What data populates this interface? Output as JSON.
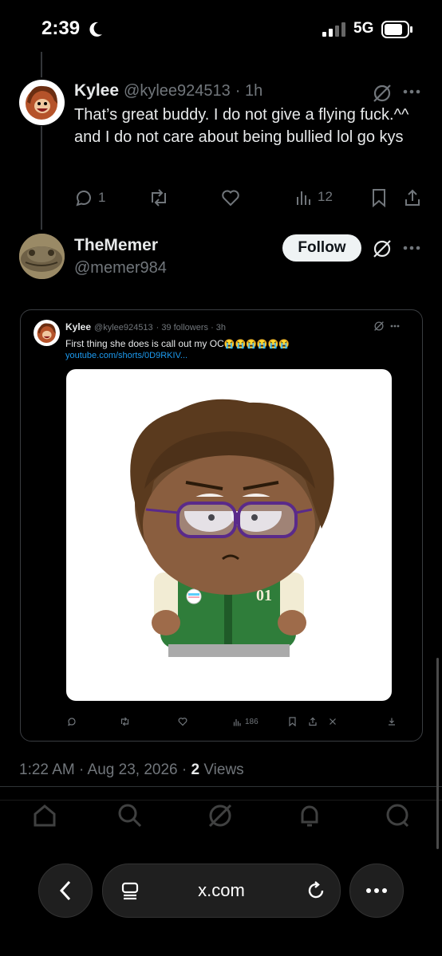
{
  "status_bar": {
    "time": "2:39",
    "network": "5G"
  },
  "reply_tweet": {
    "name": "Kylee",
    "handle": "@kylee924513",
    "time": "· 1h",
    "text": "That’s great buddy. I do not give a flying fuck.^^ and I do not care about being bullied lol go kys",
    "replies": "1",
    "views": "12"
  },
  "main_tweet": {
    "name": "TheMemer",
    "handle": "@memer984",
    "follow_label": "Follow",
    "timestamp": "1:22 AM · Aug 23, 2026 · ",
    "views_count": "2",
    "views_label": "Views"
  },
  "embedded_screenshot": {
    "name": "Kylee",
    "handle": "@kylee924513",
    "meta": "· 39 followers · 3h",
    "text": "First thing she does is call out my OC",
    "emoji": "😭😭😭😭😭😭",
    "link": "youtube.com/shorts/0D9RKIV...",
    "views": "186",
    "badge_text": "01"
  },
  "browser": {
    "url": "x.com"
  },
  "colors": {
    "background": "#000000",
    "text": "#e7e9ea",
    "muted": "#71767b",
    "link": "#1d9bf0",
    "jacket_green": "#2f7d3a"
  },
  "icons": [
    "moon-icon",
    "signal-icon",
    "battery-icon",
    "grok-icon",
    "more-icon",
    "reply-icon",
    "retweet-icon",
    "like-icon",
    "views-icon",
    "bookmark-icon",
    "share-icon",
    "home-icon",
    "search-icon",
    "notifications-icon",
    "messages-icon",
    "back-icon",
    "tabs-icon",
    "reload-icon",
    "menu-icon"
  ]
}
